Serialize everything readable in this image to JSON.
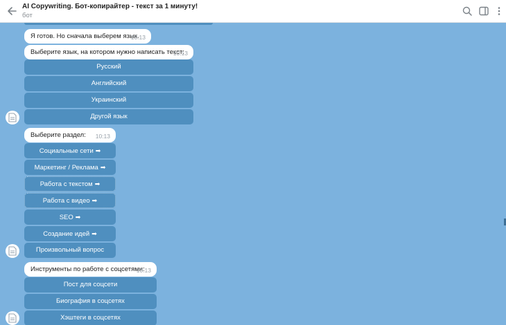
{
  "header": {
    "title": "AI Copywriting. Бот-копирайтер - текст за 1 минуту!",
    "subtitle": "бот",
    "icons": [
      "back-arrow-icon",
      "search-icon",
      "sidebar-toggle-icon",
      "more-vertical-icon"
    ]
  },
  "messages": {
    "m1": {
      "text": "Я готов. Но сначала выберем язык.",
      "time": "10:13"
    },
    "m2": {
      "text": "Выберите язык, на котором нужно написать текст:",
      "time": "10:13"
    },
    "m3": {
      "text": "Выберите раздел:",
      "time": "10:13"
    },
    "m4": {
      "text": "Инструменты по работе с соцсетями:",
      "time": "10:13"
    }
  },
  "keyboards": {
    "language": [
      "Русский",
      "Английский",
      "Украинский",
      "Другой язык"
    ],
    "sections": [
      "Социальные сети",
      "Маркетинг / Реклама",
      "Работа с текстом",
      "Работа с видео",
      "SEO",
      "Создание идей",
      "Произвольный вопрос"
    ],
    "social": [
      "Пост для соцсети",
      "Биография в соцсетях",
      "Хэштеги в соцсетях"
    ]
  },
  "arrow_glyph": "➡",
  "colors": {
    "background": "#7cb2de",
    "button": "#4f8fbf",
    "bubble": "#ffffff"
  }
}
